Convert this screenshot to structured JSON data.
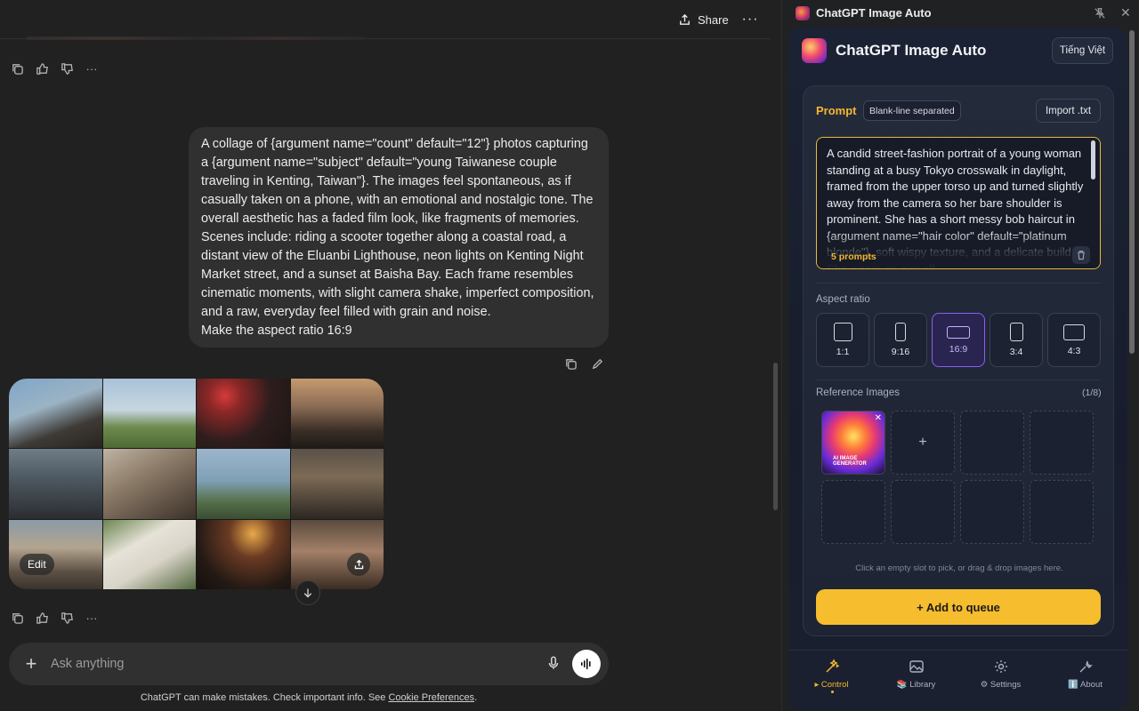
{
  "chat": {
    "share_label": "Share",
    "user_message": "A collage of {argument name=\"count\" default=\"12\"} photos capturing a {argument name=\"subject\" default=\"young Taiwanese couple traveling in Kenting, Taiwan\"}. The images feel spontaneous, as if casually taken on a phone, with an emotional and nostalgic tone. The overall aesthetic has a faded film look, like fragments of memories. Scenes include: riding a scooter together along a coastal road, a distant view of the Eluanbi Lighthouse, neon lights on Kenting Night Market street, and a sunset at Baisha Bay. Each frame resembles cinematic moments, with slight camera shake, imperfect composition, and a raw, everyday feel filled with grain and noise.",
    "user_message_tail": "Make the aspect ratio 16:9",
    "image_edit_label": "Edit",
    "composer_placeholder": "Ask anything",
    "disclaimer_text": "ChatGPT can make mistakes. Check important info. See",
    "disclaimer_link": "Cookie Preferences",
    "disclaimer_end": "."
  },
  "panel": {
    "window_title": "ChatGPT Image Auto",
    "app_title": "ChatGPT Image Auto",
    "language_button": "Tiếng Việt",
    "prompt_label": "Prompt",
    "prompt_badge": "Blank-line separated",
    "import_button": "Import .txt",
    "prompt_text": "A candid street-fashion portrait of a young woman standing at a busy Tokyo crosswalk in daylight, framed from the upper torso up and turned slightly away from the camera so her bare shoulder is prominent. She has a short messy bob haircut in {argument name=\"hair color\" default=\"platinum blonde\"}, soft wispy texture, and a delicate build. She wears an airy off-",
    "prompt_count": "5 prompts",
    "aspect_label": "Aspect ratio",
    "aspect_ratios": [
      "1:1",
      "9:16",
      "16:9",
      "3:4",
      "4:3"
    ],
    "aspect_selected": "16:9",
    "reference_label": "Reference Images",
    "reference_count": "(1/8)",
    "reference_add": "+",
    "reference_hint": "Click an empty slot to pick, or drag & drop images here.",
    "reference_thumb_caption": "AI IMAGE GENERATOR",
    "queue_button": "+ Add to queue",
    "nav": {
      "control": "▸ Control",
      "library": "📚 Library",
      "settings": "⚙ Settings",
      "about": "ℹ️ About"
    }
  },
  "colors": {
    "accent_yellow": "#f6bd2e",
    "accent_purple": "#8b5cf6",
    "chat_bg": "#212121"
  }
}
